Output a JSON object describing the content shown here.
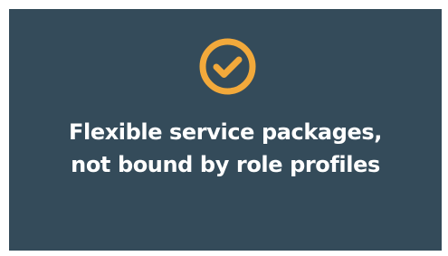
{
  "card": {
    "background": "#344b5a",
    "icon": "check-circle-icon",
    "icon_color": "#f2a93b",
    "headline_lines": [
      "Flexible service packages,",
      "not bound by role profiles"
    ],
    "text_color": "#ffffff"
  }
}
